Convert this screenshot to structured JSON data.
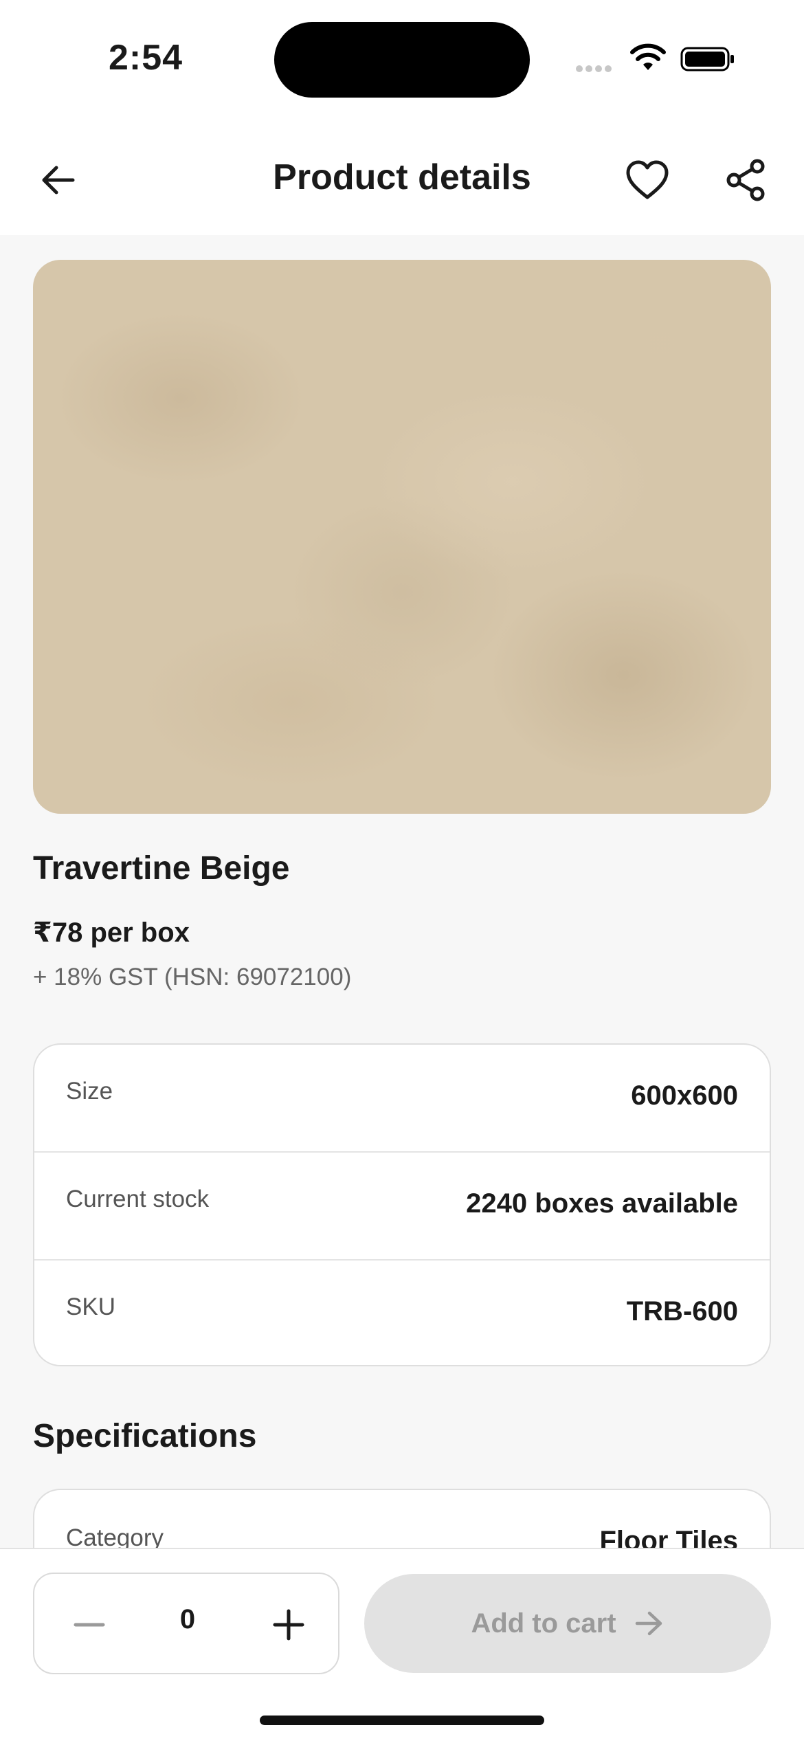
{
  "status_bar": {
    "time": "2:54",
    "icons": [
      "cellular-signal-icon",
      "wifi-icon",
      "battery-icon"
    ]
  },
  "header": {
    "title": "Product details",
    "icons": [
      "arrow-left-icon",
      "heart-icon",
      "share-icon"
    ]
  },
  "product": {
    "name": "Travertine Beige",
    "price": "₹78 per box",
    "tax": "+ 18% GST (HSN: 69072100)"
  },
  "attributes": [
    {
      "label": "Size",
      "value": "600x600"
    },
    {
      "label": "Current stock",
      "value": "2240 boxes available"
    },
    {
      "label": "SKU",
      "value": "TRB-600"
    }
  ],
  "specifications": {
    "heading": "Specifications",
    "rows": [
      {
        "label": "Category",
        "value": "Floor Tiles"
      }
    ]
  },
  "cart": {
    "quantity": "0",
    "add_label": "Add to cart",
    "button_state": "disabled"
  },
  "colors": {
    "background": "#f7f7f7",
    "card": "#ffffff",
    "tile": "#d6c6aa",
    "disabled_button": "#e2e2e2",
    "disabled_text": "#9a9a9a"
  }
}
